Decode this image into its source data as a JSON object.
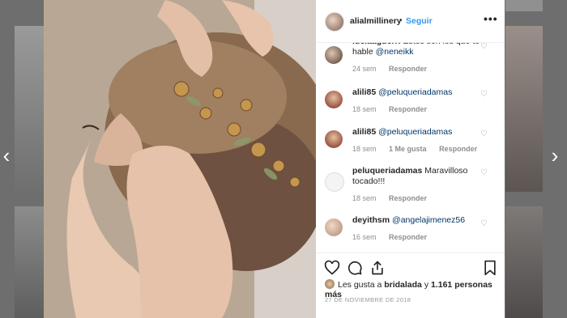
{
  "header": {
    "username": "alialmillinery",
    "separator": "•",
    "follow_label": "Seguir",
    "more_label": "•••"
  },
  "comments": [
    {
      "username": "luciaaguerri",
      "text": "Estos son los que te hable",
      "mention": "@neneikk",
      "time": "24 sem",
      "likes": "",
      "reply": "Responder"
    },
    {
      "username": "alili85",
      "text": "",
      "mention": "@peluqueriadamas",
      "time": "18 sem",
      "likes": "",
      "reply": "Responder"
    },
    {
      "username": "alili85",
      "text": "",
      "mention": "@peluqueriadamas",
      "time": "18 sem",
      "likes": "1 Me gusta",
      "reply": "Responder"
    },
    {
      "username": "peluqueriadamas",
      "text": "Maravilloso tocado!!!",
      "mention": "",
      "time": "18 sem",
      "likes": "",
      "reply": "Responder"
    },
    {
      "username": "deyithsm",
      "text": "",
      "mention": "@angelajimenez56",
      "time": "16 sem",
      "likes": "",
      "reply": "Responder"
    }
  ],
  "likes": {
    "prefix": "Les gusta a",
    "user": "bridalada",
    "connector": "y",
    "count": "1.161 personas más"
  },
  "date": "27 DE NOVIEMBRE DE 2018",
  "icons": {
    "nav_left": "chevron-left-icon",
    "nav_right": "chevron-right-icon",
    "like": "heart-icon",
    "comment": "comment-bubble-icon",
    "share": "share-icon",
    "save": "bookmark-icon"
  },
  "colors": {
    "link": "#3897f0",
    "mention": "#003569",
    "text": "#262626",
    "meta": "#8e8e8e"
  }
}
